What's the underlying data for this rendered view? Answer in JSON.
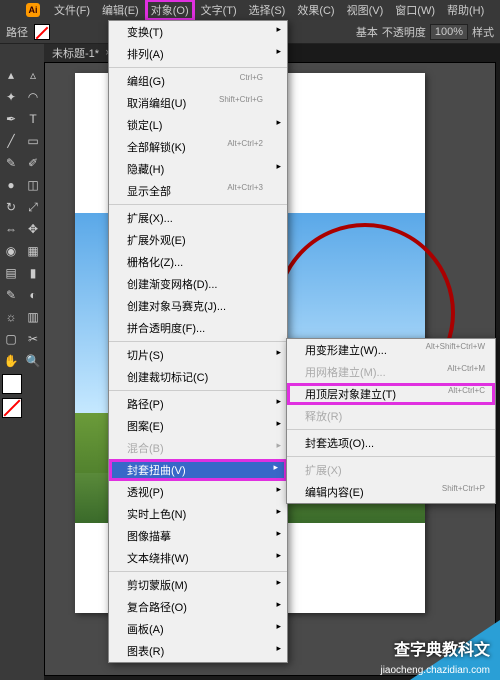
{
  "menubar": {
    "file": "文件(F)",
    "edit": "编辑(E)",
    "object": "对象(O)",
    "type": "文字(T)",
    "select": "选择(S)",
    "effect": "效果(C)",
    "view": "视图(V)",
    "window": "窗口(W)",
    "help": "帮助(H)"
  },
  "toolbar": {
    "path_label": "路径",
    "basic": "基本",
    "opacity_label": "不透明度",
    "opacity_value": "100%",
    "style_label": "样式"
  },
  "doc": {
    "title": "未标题-1*",
    "close": "×"
  },
  "menu": {
    "transform": "变换(T)",
    "arrange": "排列(A)",
    "group": "编组(G)",
    "group_sc": "Ctrl+G",
    "ungroup": "取消编组(U)",
    "ungroup_sc": "Shift+Ctrl+G",
    "lock": "锁定(L)",
    "unlock": "全部解锁(K)",
    "unlock_sc": "Alt+Ctrl+2",
    "hide": "隐藏(H)",
    "showall": "显示全部",
    "showall_sc": "Alt+Ctrl+3",
    "expand": "扩展(X)...",
    "expand_app": "扩展外观(E)",
    "rasterize": "栅格化(Z)...",
    "gradient_mesh": "创建渐变网格(D)...",
    "mosaic": "创建对象马赛克(J)...",
    "flatten": "拼合透明度(F)...",
    "slice": "切片(S)",
    "crop": "创建裁切标记(C)",
    "path": "路径(P)",
    "pattern": "图案(E)",
    "blend": "混合(B)",
    "envelope": "封套扭曲(V)",
    "perspective": "透视(P)",
    "livepaint": "实时上色(N)",
    "imagetrace": "图像描摹",
    "textwrap": "文本绕排(W)",
    "clipmask": "剪切蒙版(M)",
    "compound": "复合路径(O)",
    "artboard": "画板(A)",
    "graph": "图表(R)"
  },
  "submenu": {
    "warp": "用变形建立(W)...",
    "warp_sc": "Alt+Shift+Ctrl+W",
    "mesh": "用网格建立(M)...",
    "mesh_sc": "Alt+Ctrl+M",
    "top": "用顶层对象建立(T)",
    "top_sc": "Alt+Ctrl+C",
    "release": "释放(R)",
    "options": "封套选项(O)...",
    "expand": "扩展(X)",
    "editcontent": "编辑内容(E)",
    "editcontent_sc": "Shift+Ctrl+P"
  },
  "watermark": {
    "text": "查字典教科文",
    "site": "jiaocheng.chazidian.com"
  }
}
